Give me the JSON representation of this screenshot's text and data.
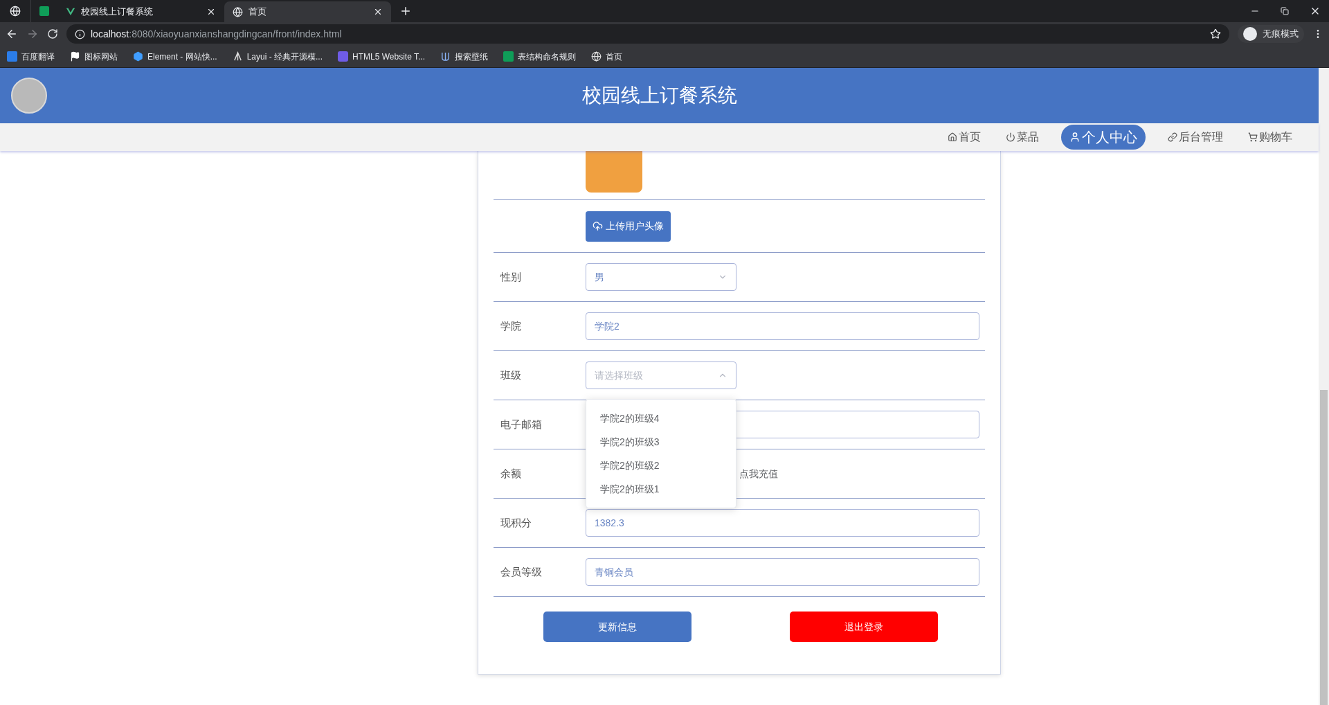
{
  "browser": {
    "tabs": [
      {
        "title": "校园线上订餐系统",
        "selected": false
      },
      {
        "title": "首页",
        "selected": true
      }
    ],
    "url": {
      "host": "localhost",
      "path": ":8080/xiaoyuanxianshangdingcan/front/index.html"
    },
    "profile_label": "无痕模式",
    "bookmarks": [
      "百度翻译",
      "图标网站",
      "Element - 网站快...",
      "Layui - 经典开源模...",
      "HTML5 Website T...",
      "搜索壁纸",
      "表结构命名规则",
      "首页"
    ]
  },
  "site": {
    "title": "校园线上订餐系统",
    "nav": [
      {
        "label": "首页",
        "selected": false
      },
      {
        "label": "菜品",
        "selected": false
      },
      {
        "label": "个人中心",
        "selected": true
      },
      {
        "label": "后台管理",
        "selected": false
      },
      {
        "label": "购物车",
        "selected": false
      }
    ]
  },
  "form": {
    "upload_button": "上传用户头像",
    "fields": [
      {
        "kind": "select",
        "label": "性别",
        "value": "男",
        "expanded": false
      },
      {
        "kind": "input",
        "label": "学院",
        "value": "学院2"
      },
      {
        "kind": "select",
        "label": "班级",
        "placeholder": "请选择班级",
        "expanded": true,
        "options": [
          "学院2的班级4",
          "学院2的班级3",
          "学院2的班级2",
          "学院2的班级1"
        ]
      },
      {
        "kind": "input",
        "label": "电子邮箱"
      },
      {
        "kind": "balance",
        "label": "余额",
        "link": "点我充值"
      },
      {
        "kind": "input",
        "label": "现积分",
        "value": "1382.3"
      },
      {
        "kind": "input",
        "label": "会员等级",
        "value": "青铜会员"
      }
    ],
    "buttons": [
      {
        "label": "更新信息",
        "kind": "primary"
      },
      {
        "label": "退出登录",
        "kind": "danger"
      }
    ]
  }
}
